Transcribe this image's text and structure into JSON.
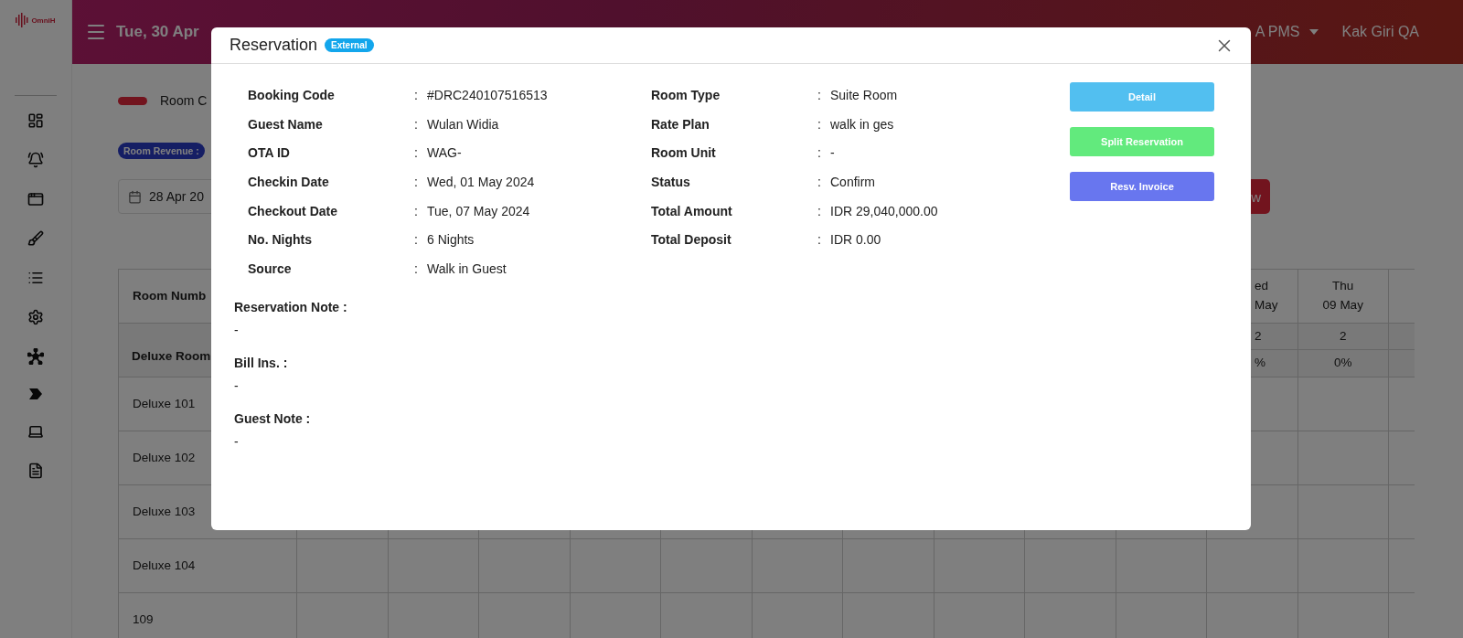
{
  "sidebar": {
    "logo_text": "OmniH"
  },
  "topbar": {
    "date": "Tue, 30 Apr",
    "property": "A PMS",
    "user": "Kak Giri QA"
  },
  "legend": {
    "label": "Room C"
  },
  "revenue_badge": "Room Revenue :",
  "date_field": {
    "value": "28 Apr 20"
  },
  "cut_button": "w",
  "table": {
    "first_header": "Room Numb",
    "day_headers": [
      {
        "line_1": "ed",
        "line_2": "May"
      },
      {
        "line_1": "Thu",
        "line_2": "09 May"
      }
    ],
    "category": {
      "name": "Deluxe Room",
      "counts": [
        "2",
        "2"
      ],
      "occupancy": [
        "%",
        "0%"
      ]
    },
    "rows": [
      "Deluxe 101",
      "Deluxe 102",
      "Deluxe 103",
      "Deluxe 104",
      "109"
    ]
  },
  "reservation_modal": {
    "title": "Reservation",
    "badge": "External",
    "left_fields": [
      {
        "label": "Booking Code",
        "value": "#DRC240107516513"
      },
      {
        "label": "Guest Name",
        "value": "Wulan Widia"
      },
      {
        "label": "OTA ID",
        "value": "WAG-"
      },
      {
        "label": "Checkin Date",
        "value": "Wed, 01 May 2024"
      },
      {
        "label": "Checkout Date",
        "value": "Tue, 07 May 2024"
      },
      {
        "label": "No. Nights",
        "value": "6 Nights"
      },
      {
        "label": "Source",
        "value": "Walk in Guest"
      }
    ],
    "right_fields": [
      {
        "label": "Room Type",
        "value": "Suite Room"
      },
      {
        "label": "Rate Plan",
        "value": "walk in ges"
      },
      {
        "label": "Room Unit",
        "value": "-"
      },
      {
        "label": "Status",
        "value": "Confirm"
      },
      {
        "label": "Total Amount",
        "value": "IDR 29,040,000.00"
      },
      {
        "label": "Total Deposit",
        "value": "IDR 0.00"
      }
    ],
    "separator": ":",
    "buttons": [
      {
        "label": "Detail",
        "kind": "info"
      },
      {
        "label": "Split Reservation",
        "kind": "success"
      },
      {
        "label": "Resv. Invoice",
        "kind": "primary"
      }
    ],
    "notes": [
      {
        "label": "Reservation Note :",
        "value": "-"
      },
      {
        "label": "Bill Ins. :",
        "value": "-"
      },
      {
        "label": "Guest Note :",
        "value": "-"
      }
    ]
  }
}
